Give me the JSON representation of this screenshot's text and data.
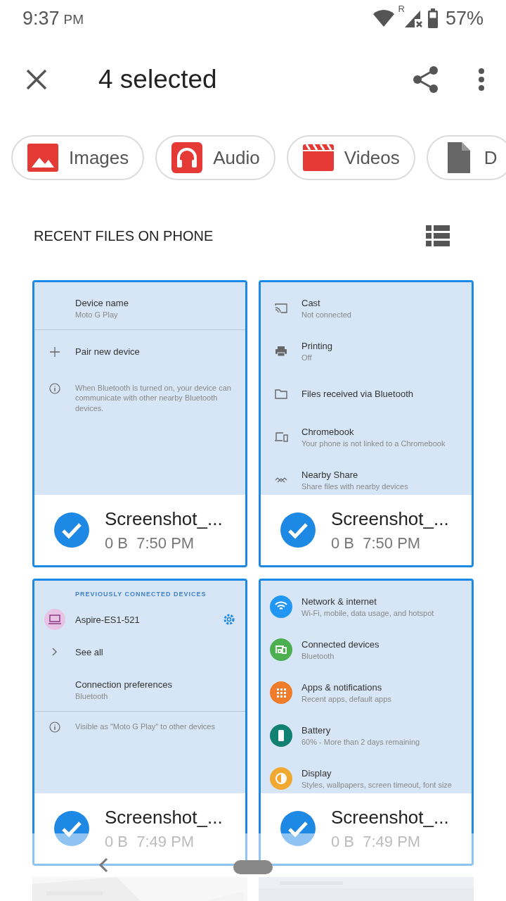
{
  "status_bar": {
    "time": "9:37",
    "ampm": "PM",
    "roaming": "R",
    "battery": "57%"
  },
  "top_bar": {
    "title": "4 selected"
  },
  "chips": [
    {
      "label": "Images",
      "kind": "images"
    },
    {
      "label": "Audio",
      "kind": "audio"
    },
    {
      "label": "Videos",
      "kind": "videos"
    },
    {
      "label": "D",
      "kind": "documents"
    }
  ],
  "section": {
    "title": "RECENT FILES ON PHONE"
  },
  "files": [
    {
      "name": "Screenshot_...",
      "meta": "0 B  7:50 PM",
      "selected": true,
      "thumbnail": [
        {
          "kind": "plain",
          "title": "Device name",
          "subtitle": "Moto G Play",
          "divider": true
        },
        {
          "kind": "plus",
          "title": "Pair new device"
        },
        {
          "kind": "info",
          "text": "When Bluetooth is turned on, your device can communicate with other nearby Bluetooth devices."
        }
      ]
    },
    {
      "name": "Screenshot_...",
      "meta": "0 B  7:50 PM",
      "selected": true,
      "thumbnail": [
        {
          "kind": "cast",
          "title": "Cast",
          "subtitle": "Not connected"
        },
        {
          "kind": "print",
          "title": "Printing",
          "subtitle": "Off"
        },
        {
          "kind": "folder",
          "title": "Files received via Bluetooth"
        },
        {
          "kind": "chromebook",
          "title": "Chromebook",
          "subtitle": "Your phone is not linked to a Chromebook"
        },
        {
          "kind": "nearby",
          "title": "Nearby Share",
          "subtitle": "Share files with nearby devices"
        }
      ]
    },
    {
      "name": "Screenshot_...",
      "meta": "0 B  7:49 PM",
      "selected": true,
      "thumbnail": [
        {
          "kind": "header",
          "title": "PREVIOUSLY CONNECTED DEVICES"
        },
        {
          "kind": "laptop",
          "title": "Aspire-ES1-521"
        },
        {
          "kind": "chevron",
          "title": "See all"
        },
        {
          "kind": "plain",
          "title": "Connection preferences",
          "subtitle": "Bluetooth",
          "divider": true
        },
        {
          "kind": "info",
          "text": "Visible as \"Moto G Play\" to other devices"
        }
      ]
    },
    {
      "name": "Screenshot_...",
      "meta": "0 B  7:49 PM",
      "selected": true,
      "thumbnail": [
        {
          "kind": "wifi",
          "title": "Network & internet",
          "subtitle": "Wi-Fi, mobile, data usage, and hotspot",
          "color": "#2196f3"
        },
        {
          "kind": "devices",
          "title": "Connected devices",
          "subtitle": "Bluetooth",
          "color": "#4caf50"
        },
        {
          "kind": "apps",
          "title": "Apps & notifications",
          "subtitle": "Recent apps, default apps",
          "color": "#ef7c2a"
        },
        {
          "kind": "battery",
          "title": "Battery",
          "subtitle": "60% - More than 2 days remaining",
          "color": "#138074"
        },
        {
          "kind": "display",
          "title": "Display",
          "subtitle": "Styles, wallpapers, screen timeout, font size",
          "color": "#f0a830"
        }
      ]
    }
  ]
}
